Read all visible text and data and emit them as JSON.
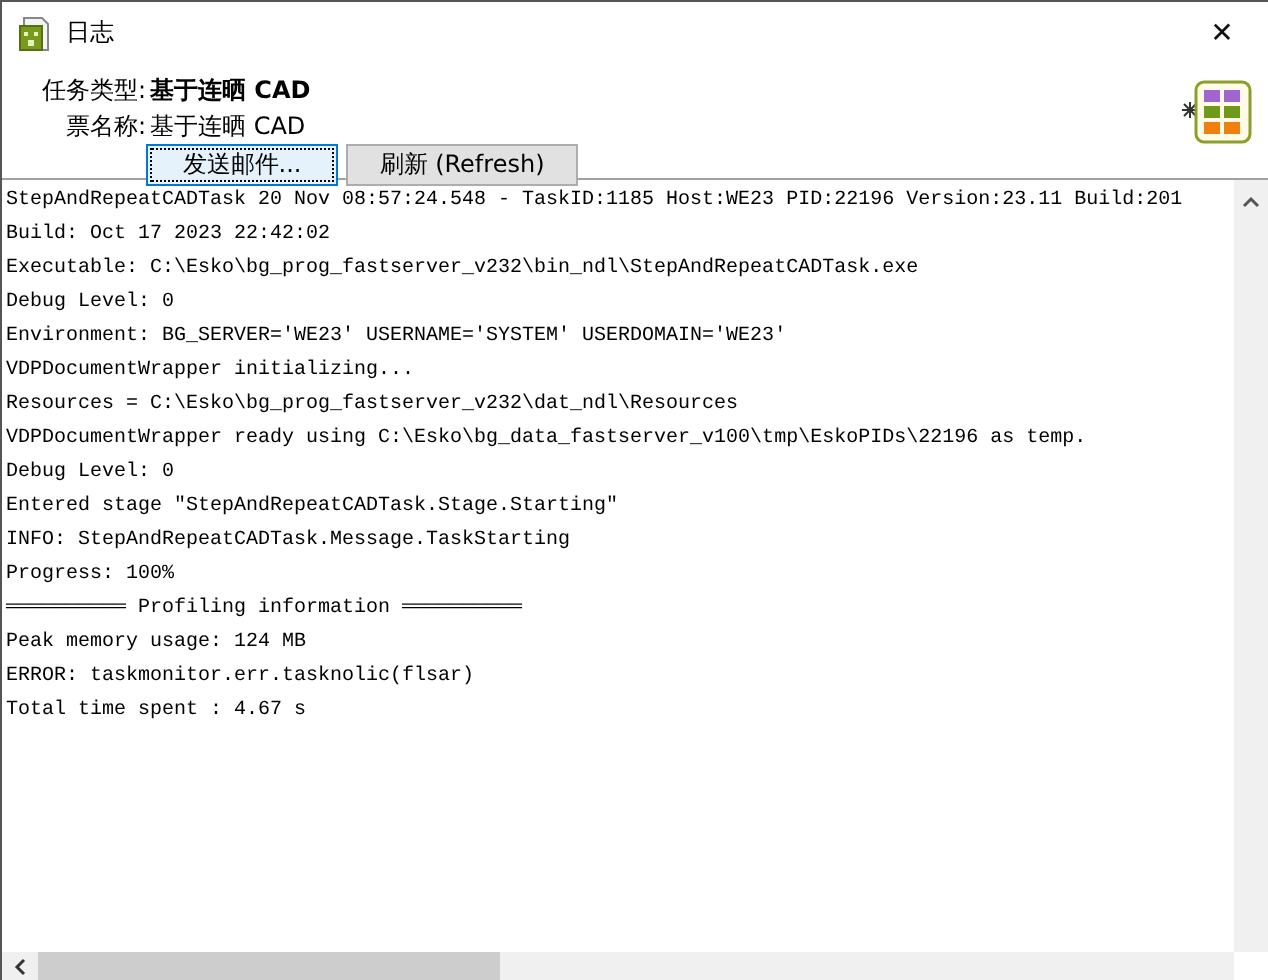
{
  "window": {
    "title": "日志",
    "close": "✕"
  },
  "fields": [
    {
      "label": "任务类型:",
      "value": "基于连晒 CAD",
      "bold": true
    },
    {
      "label": "票名称:",
      "value": "基于连晒 CAD",
      "bold": false
    }
  ],
  "buttons": [
    {
      "label": "发送邮件...",
      "focused": true
    },
    {
      "label": "刷新 (Refresh)",
      "focused": false
    }
  ],
  "log": [
    "StepAndRepeatCADTask 20 Nov 08:57:24.548 - TaskID:1185 Host:WE23 PID:22196 Version:23.11 Build:201",
    "Build: Oct 17 2023 22:42:02",
    "Executable: C:\\Esko\\bg_prog_fastserver_v232\\bin_ndl\\StepAndRepeatCADTask.exe",
    "Debug Level: 0",
    "Environment: BG_SERVER='WE23' USERNAME='SYSTEM' USERDOMAIN='WE23'",
    "VDPDocumentWrapper initializing...",
    "Resources = C:\\Esko\\bg_prog_fastserver_v232\\dat_ndl\\Resources",
    "VDPDocumentWrapper ready using C:\\Esko\\bg_data_fastserver_v100\\tmp\\EskoPIDs\\22196 as temp.",
    "Debug Level: 0",
    "Entered stage \"StepAndRepeatCADTask.Stage.Starting\"",
    "INFO: StepAndRepeatCADTask.Message.TaskStarting",
    "Progress: 100%",
    "══════════ Profiling information ══════════",
    "Peak memory usage: 124 MB",
    "ERROR: taskmonitor.err.tasknolic(flsar)",
    "Total time spent : 4.67 s"
  ]
}
